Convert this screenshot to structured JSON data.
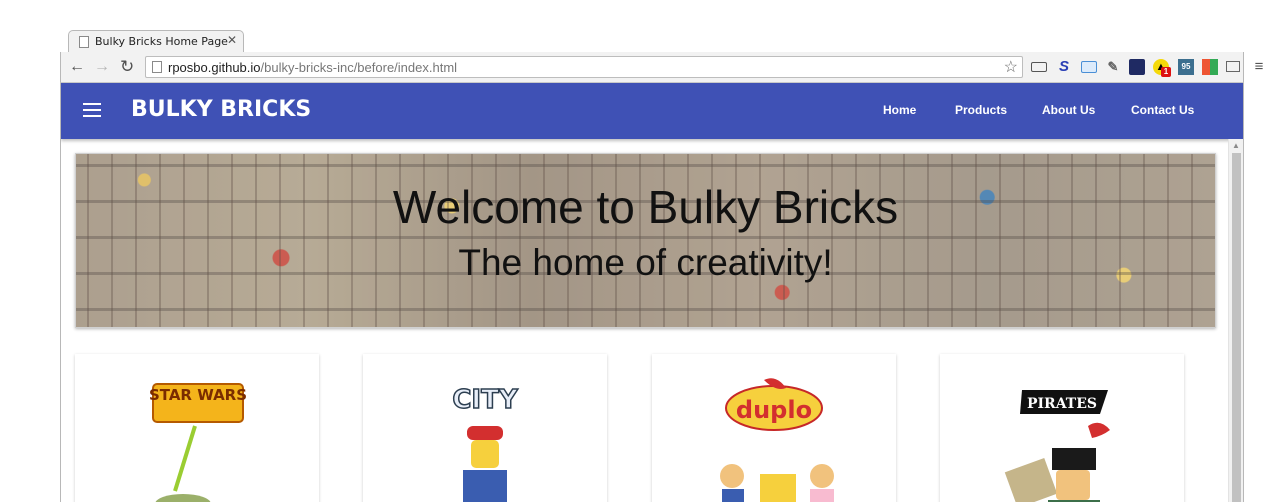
{
  "browser": {
    "tab_title": "Bulky Bricks Home Page",
    "url_domain": "rposbo.github.io",
    "url_path": "/bulky-bricks-inc/before/index.html"
  },
  "extensions": [
    "S",
    "95",
    "1"
  ],
  "site": {
    "brand": "BULKY BRICKS",
    "nav": [
      "Home",
      "Products",
      "About Us",
      "Contact Us"
    ]
  },
  "hero": {
    "title": "Welcome to Bulky Bricks",
    "subtitle": "The home of creativity!"
  },
  "cards": [
    {
      "logo": "STAR WARS",
      "icon": "star-wars-logo-icon"
    },
    {
      "logo": "CITY",
      "icon": "city-logo-icon"
    },
    {
      "logo": "duplo",
      "icon": "duplo-logo-icon"
    },
    {
      "logo": "PIRATES",
      "icon": "pirates-logo-icon"
    }
  ],
  "colors": {
    "appbar": "#3f51b5",
    "accent": "#ffffff"
  }
}
